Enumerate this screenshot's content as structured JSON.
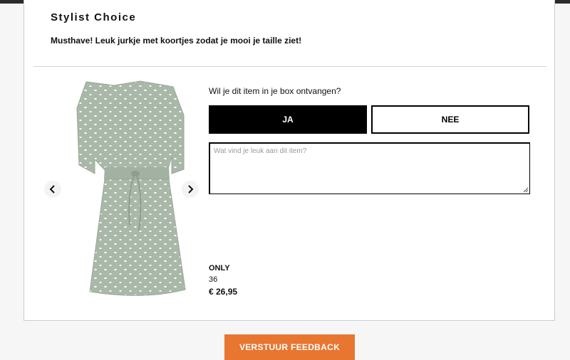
{
  "section": {
    "title": "Stylist Choice",
    "description": "Musthave! Leuk jurkje met koortjes zodat je mooi je taille ziet!"
  },
  "item": {
    "image_icon": "dress-image",
    "question": "Wil je dit item in je box ontvangen?",
    "yes_label": "JA",
    "no_label": "NEE",
    "selected": "JA",
    "comment_placeholder": "Wat vind je leuk aan dit item?",
    "comment_value": "",
    "brand": "ONLY",
    "size": "36",
    "price": "€ 26,95"
  },
  "carousel": {
    "prev_icon": "chevron-left-icon",
    "next_icon": "chevron-right-icon"
  },
  "footer": {
    "submit_label": "VERSTUUR FEEDBACK"
  },
  "colors": {
    "accent": "#e87530",
    "selected_bg": "#000000",
    "dress": "#a9b8a8"
  }
}
